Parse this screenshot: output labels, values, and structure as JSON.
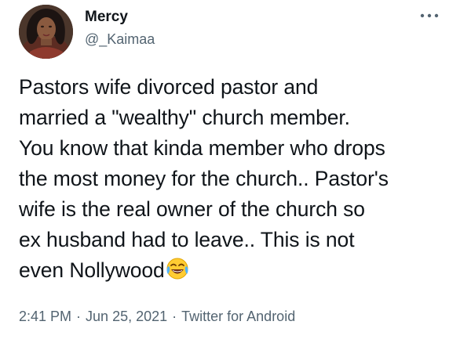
{
  "author": {
    "name": "Mercy",
    "handle": "@_Kaimaa",
    "avatar_icon": "profile-photo"
  },
  "more_icon": "more-horizontal-icon",
  "tweet": {
    "lines": [
      "Pastors wife divorced pastor and",
      "married a \"wealthy\" church member.",
      "You know that kinda member who drops",
      "the most money for the church.. Pastor's",
      "wife is the real owner of the church so",
      "ex husband had to leave.. This is not",
      "even Nollywood"
    ],
    "emoji": "face-with-tears-of-joy-emoji"
  },
  "meta": {
    "time": "2:41 PM",
    "separator": "·",
    "date": "Jun 25, 2021",
    "source": "Twitter for Android"
  },
  "colors": {
    "text": "#0f1419",
    "secondary": "#536471",
    "background": "#ffffff"
  }
}
